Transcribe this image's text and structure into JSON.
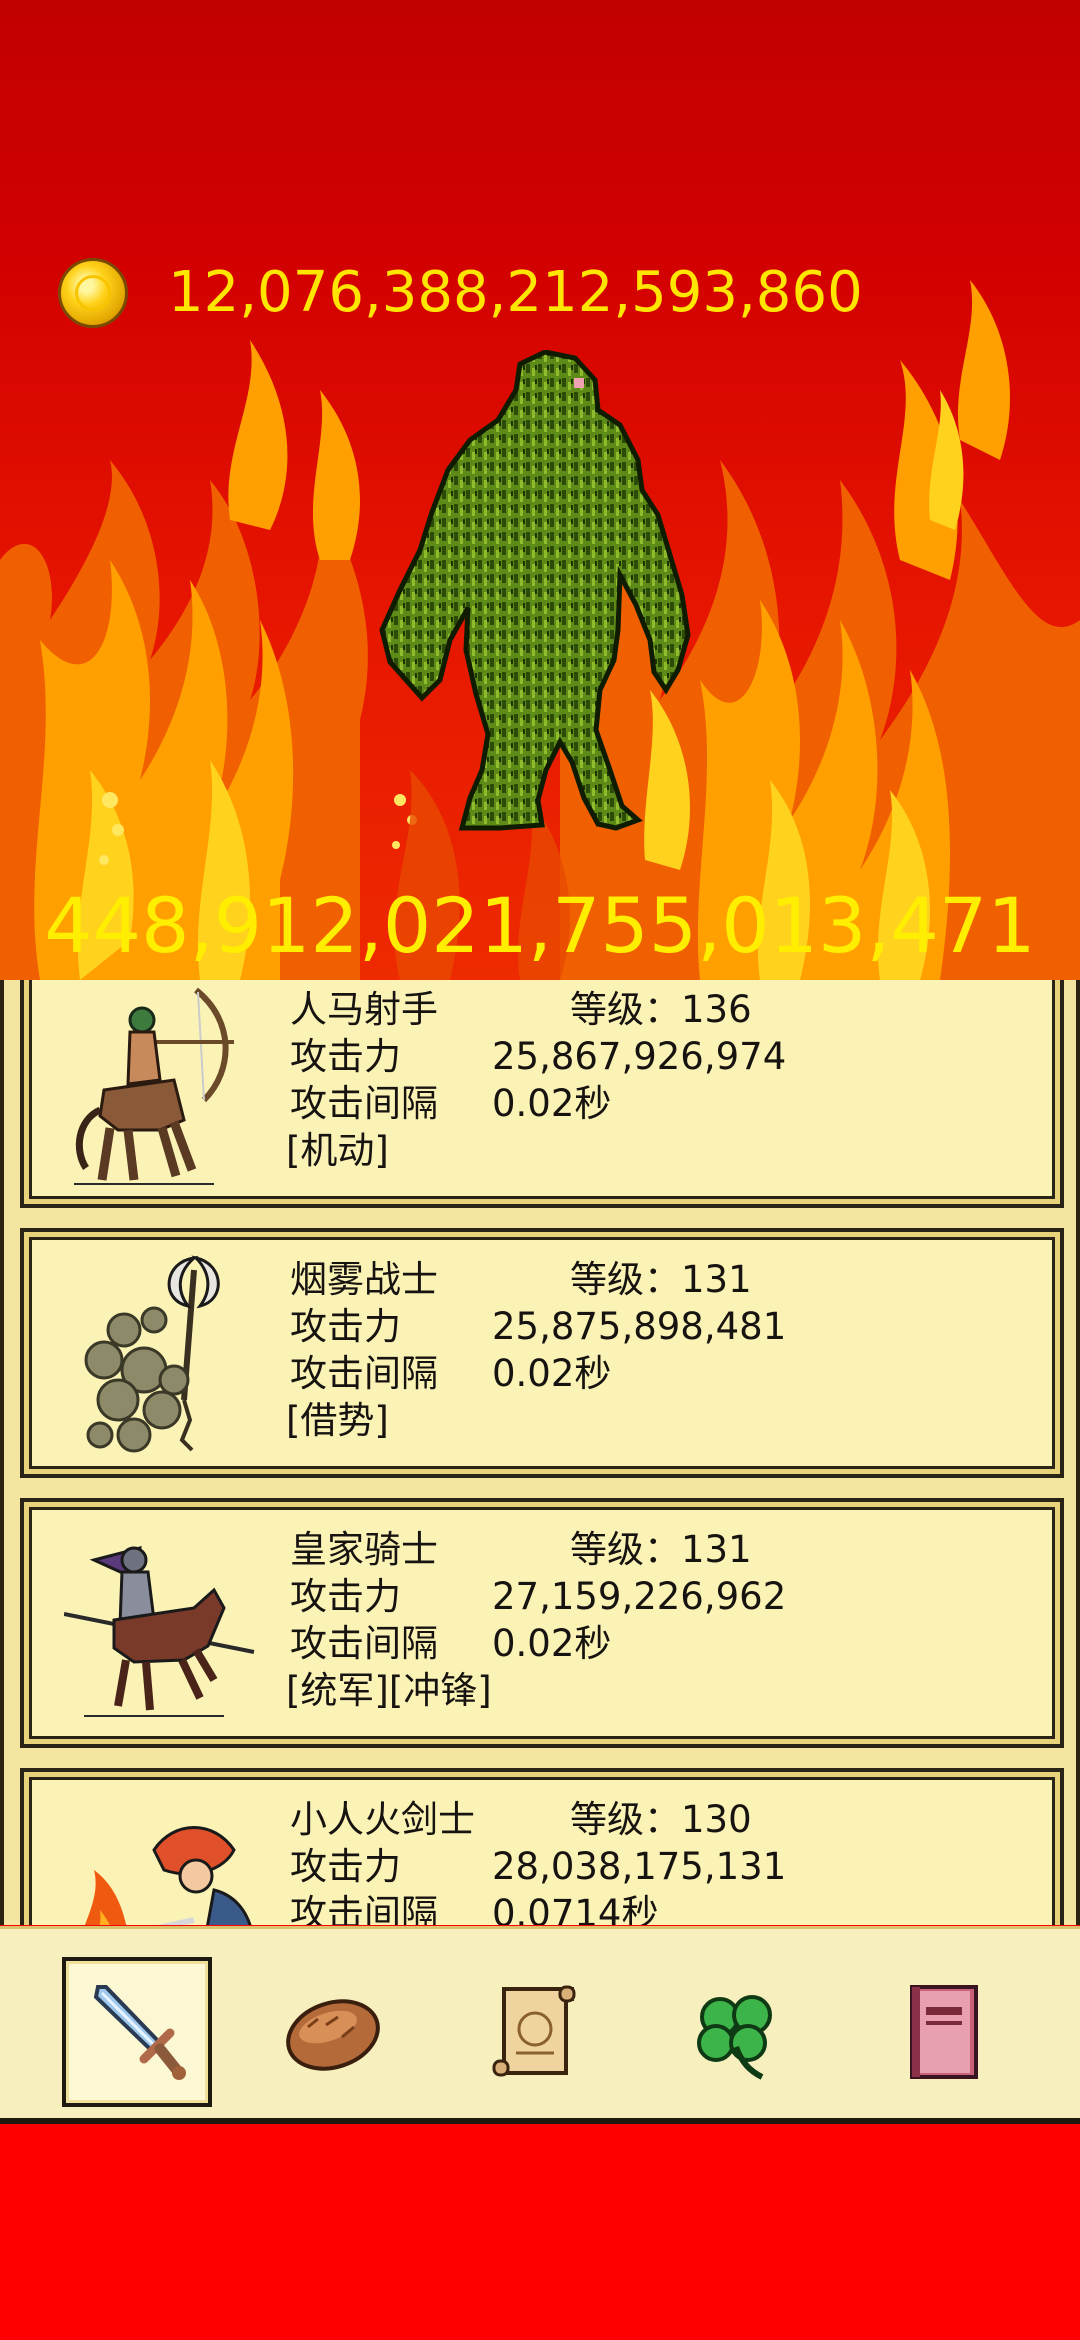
{
  "header": {
    "gold_icon": "gold-coin-icon",
    "gold_amount": "12,076,388,212,593,860"
  },
  "enemy": {
    "name_icon": "moss-golem-monster",
    "hp": "448,912,021,755,013,471"
  },
  "heroes": [
    {
      "name": "人马射手",
      "level": "等级：136",
      "attack_label": "攻击力",
      "attack": "25,867,926,974",
      "interval_label": "攻击间隔",
      "interval": "0.02秒",
      "tags": "[机动]",
      "icon": "centaur-archer-icon"
    },
    {
      "name": "烟雾战士",
      "level": "等级：131",
      "attack_label": "攻击力",
      "attack": "25,875,898,481",
      "interval_label": "攻击间隔",
      "interval": "0.02秒",
      "tags": "[借势]",
      "icon": "smoke-warrior-icon"
    },
    {
      "name": "皇家骑士",
      "level": "等级：131",
      "attack_label": "攻击力",
      "attack": "27,159,226,962",
      "interval_label": "攻击间隔",
      "interval": "0.02秒",
      "tags": "[统军][冲锋]",
      "icon": "royal-knight-icon"
    },
    {
      "name": "小人火剑士",
      "level": "等级：130",
      "attack_label": "攻击力",
      "attack": "28,038,175,131",
      "interval_label": "攻击间隔",
      "interval": "0.0714秒",
      "tags": "",
      "icon": "fire-swordsman-icon"
    }
  ],
  "nav": {
    "items": [
      {
        "icon": "sword-icon",
        "active": true
      },
      {
        "icon": "bread-icon",
        "active": false
      },
      {
        "icon": "scroll-icon",
        "active": false
      },
      {
        "icon": "clover-icon",
        "active": false
      },
      {
        "icon": "book-icon",
        "active": false
      }
    ]
  },
  "colors": {
    "sky_red": "#c20000",
    "panel": "#fbf3b6",
    "gold_text": "#ffe600"
  }
}
